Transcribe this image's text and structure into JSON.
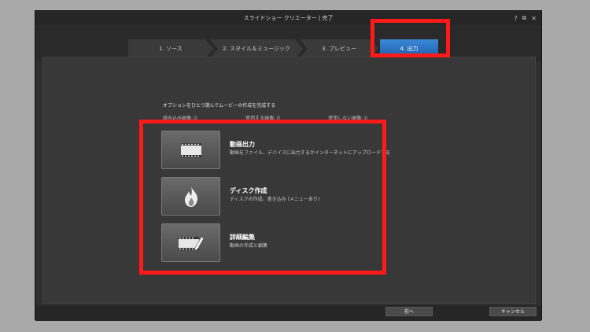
{
  "window": {
    "title": "スライドショー クリエーター | 完了",
    "controls": {
      "help": "?",
      "restore": "⧉",
      "close": "✕"
    }
  },
  "steps": [
    {
      "label": "1. ソース"
    },
    {
      "label": "2. スタイル＆ミュージック"
    },
    {
      "label": "3. プレビュー"
    },
    {
      "label": "4. 出力"
    }
  ],
  "instruction": "オプションをひとつ選んでムービーの作成を完成する",
  "counts": [
    {
      "label": "読み込み画像: 0"
    },
    {
      "label": "使用する画像: 0"
    },
    {
      "label": "使用しない画像: 0"
    }
  ],
  "options": [
    {
      "title": "動画出力",
      "desc": "動画をファイル、デバイスに出力するかインターネットにアップロードする",
      "icon": "film-icon"
    },
    {
      "title": "ディスク作成",
      "desc": "ディスクの作成、書き込み (メニューあり)",
      "icon": "flame-icon"
    },
    {
      "title": "詳細編集",
      "desc": "動画の作成と編集",
      "icon": "film-edit-icon"
    }
  ],
  "buttons": {
    "prev": "前へ",
    "cancel": "キャンセル"
  },
  "colors": {
    "highlight": "#ff1a1a",
    "active_step": "#2a72c4"
  }
}
